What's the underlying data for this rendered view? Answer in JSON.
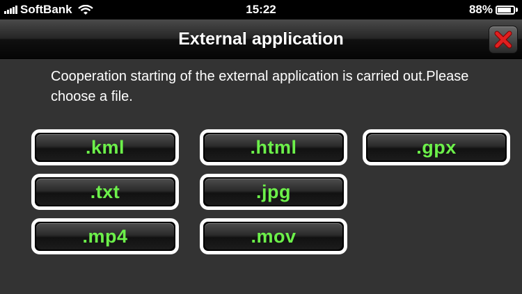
{
  "status_bar": {
    "carrier": "SoftBank",
    "time": "15:22",
    "battery_percent": "88%",
    "battery_level": 0.88
  },
  "title_bar": {
    "title": "External application",
    "close_icon": "close-x-icon",
    "close_color": "#e02020"
  },
  "message": "Cooperation starting of the external application is carried out.Please choose a file.",
  "file_buttons": [
    {
      "label": ".kml"
    },
    {
      "label": ".html"
    },
    {
      "label": ".gpx"
    },
    {
      "label": ".txt"
    },
    {
      "label": ".jpg"
    },
    {
      "label": ".mp4"
    },
    {
      "label": ".mov"
    }
  ],
  "colors": {
    "button_text": "#6cf04a",
    "background": "#333333"
  }
}
